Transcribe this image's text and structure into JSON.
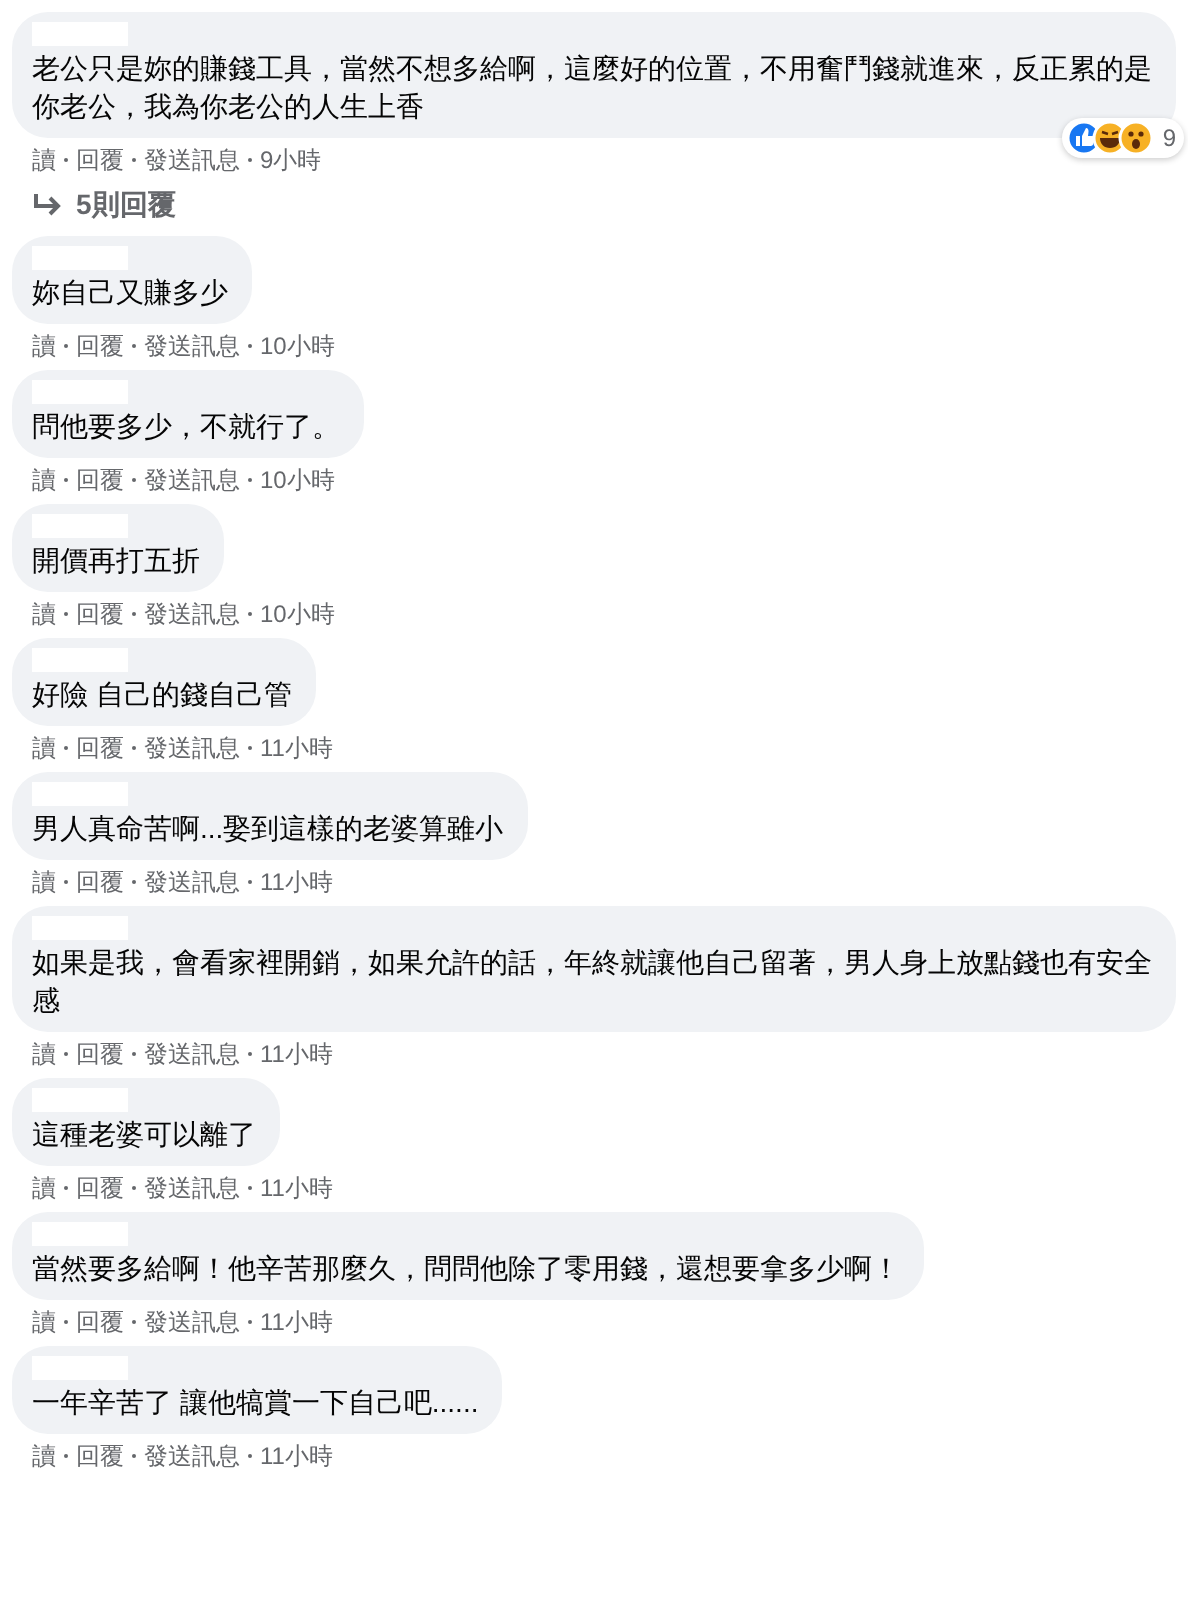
{
  "comments": [
    {
      "text": "老公只是妳的賺錢工具，當然不想多給啊，這麼好的位置，不用奮鬥錢就進來，反正累的是你老公，我為你老公的人生上香",
      "actions": [
        "讀",
        "回覆",
        "發送訊息"
      ],
      "time": "9小時",
      "reactions": {
        "count": "9"
      },
      "replies": "5則回覆"
    },
    {
      "text": "妳自己又賺多少",
      "actions": [
        "讀",
        "回覆",
        "發送訊息"
      ],
      "time": "10小時"
    },
    {
      "text": "問他要多少，不就行了。",
      "actions": [
        "讀",
        "回覆",
        "發送訊息"
      ],
      "time": "10小時"
    },
    {
      "text": "開價再打五折",
      "actions": [
        "讀",
        "回覆",
        "發送訊息"
      ],
      "time": "10小時"
    },
    {
      "text": "好險 自己的錢自己管",
      "actions": [
        "讀",
        "回覆",
        "發送訊息"
      ],
      "time": "11小時"
    },
    {
      "text": "男人真命苦啊...娶到這樣的老婆算雖小",
      "actions": [
        "讀",
        "回覆",
        "發送訊息"
      ],
      "time": "11小時"
    },
    {
      "text": "如果是我，會看家裡開銷，如果允許的話，年終就讓他自己留著，男人身上放點錢也有安全感",
      "actions": [
        "讀",
        "回覆",
        "發送訊息"
      ],
      "time": "11小時"
    },
    {
      "text": "這種老婆可以離了",
      "actions": [
        "讀",
        "回覆",
        "發送訊息"
      ],
      "time": "11小時"
    },
    {
      "text": "當然要多給啊！他辛苦那麼久，問問他除了零用錢，還想要拿多少啊！",
      "actions": [
        "讀",
        "回覆",
        "發送訊息"
      ],
      "time": "11小時"
    },
    {
      "text": "一年辛苦了 讓他犒賞一下自己吧......",
      "actions": [
        "讀",
        "回覆",
        "發送訊息"
      ],
      "time": "11小時"
    }
  ]
}
